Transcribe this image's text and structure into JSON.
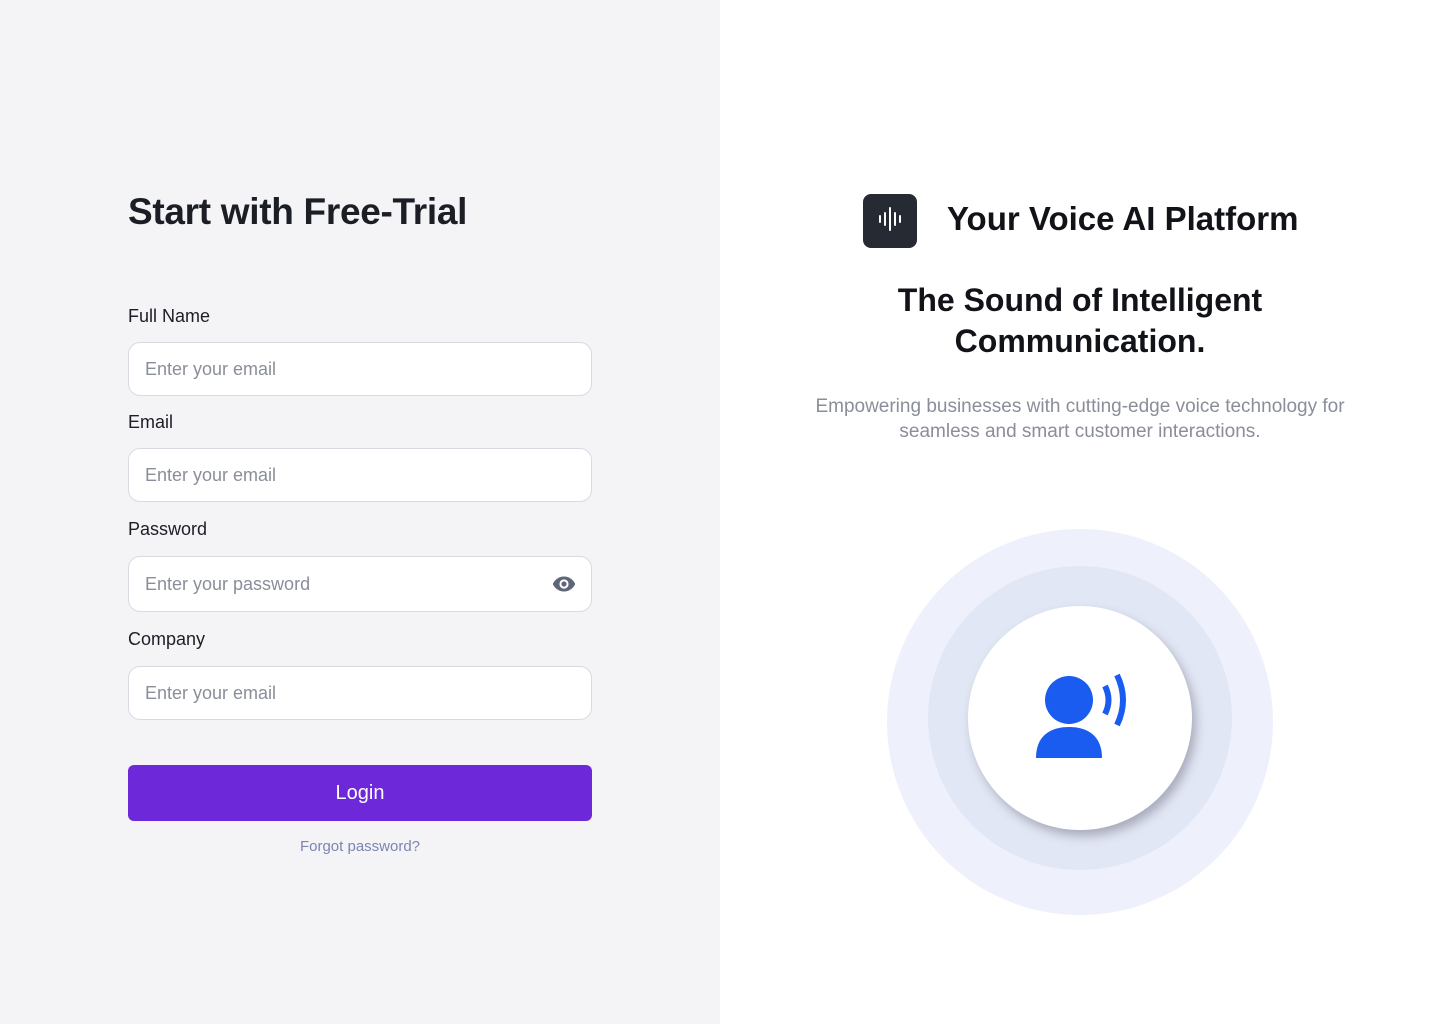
{
  "form": {
    "title": "Start with Free-Trial",
    "fields": [
      {
        "label": "Full Name",
        "placeholder": "Enter your email",
        "value": ""
      },
      {
        "label": "Email",
        "placeholder": "Enter your email",
        "value": ""
      },
      {
        "label": "Password",
        "placeholder": "Enter your password",
        "value": ""
      },
      {
        "label": "Company",
        "placeholder": "Enter your email",
        "value": ""
      }
    ],
    "password_toggle_icon": "eye-icon",
    "submit_label": "Login",
    "forgot_link": "Forgot password?"
  },
  "hero": {
    "logo_icon": "soundwave-icon",
    "brand_title": "Your Voice AI Platform",
    "headline": "The Sound of Intelligent Communication.",
    "subtext": "Empowering businesses with cutting-edge voice technology for seamless and smart customer interactions.",
    "illustration_icon": "speaking-person-icon"
  },
  "colors": {
    "left_background": "#f4f4f7",
    "right_background": "#ffffff",
    "primary_button": "#6d28d9",
    "link": "#7b84b3",
    "illustration_accent": "#1a5cf0",
    "logo_background": "#262a33"
  }
}
